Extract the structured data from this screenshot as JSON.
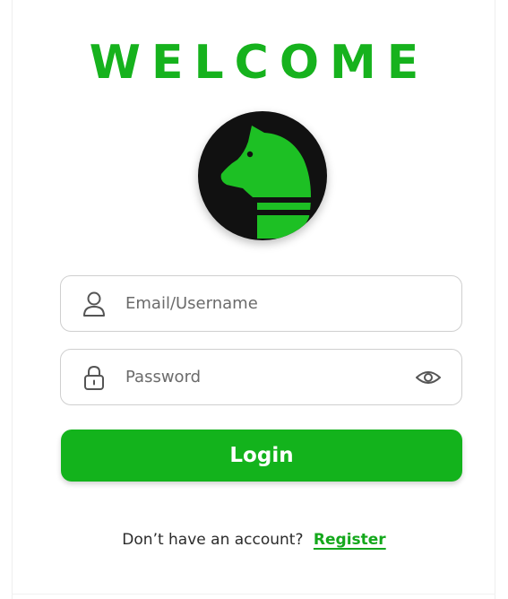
{
  "colors": {
    "brand_green": "#16b21d",
    "logo_background": "#111111",
    "field_border": "#cfcfcf",
    "placeholder_text": "#6b6b6b"
  },
  "header": {
    "title": "WELCOME"
  },
  "logo": {
    "icon": "knight-horse-icon"
  },
  "form": {
    "email": {
      "icon": "user-icon",
      "value": "",
      "placeholder": "Email/Username"
    },
    "password": {
      "icon": "lock-icon",
      "value": "",
      "placeholder": "Password",
      "toggle_icon": "eye-icon"
    },
    "login_label": "Login"
  },
  "footer": {
    "prompt": "Don’t have an account?",
    "register_label": "Register"
  }
}
